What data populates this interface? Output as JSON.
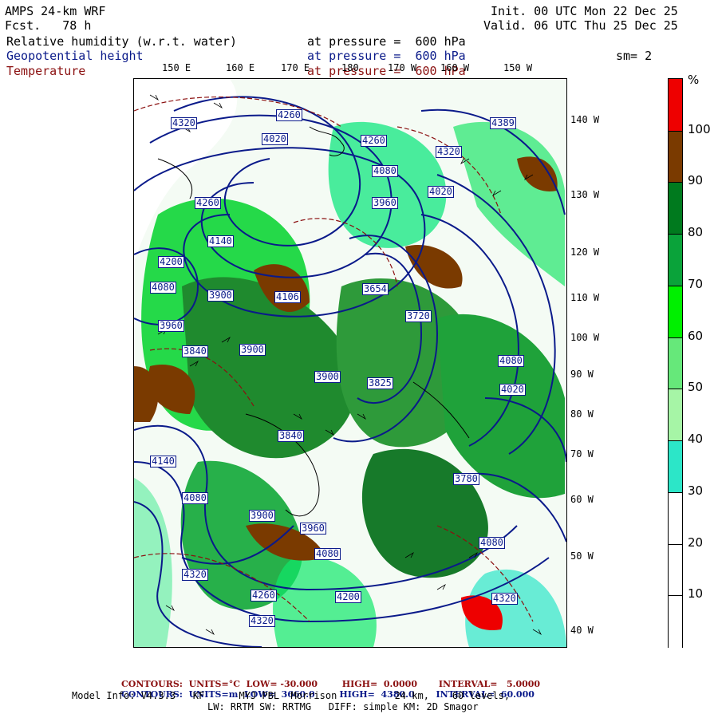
{
  "header": {
    "model": "AMPS 24-km WRF",
    "fcst": "Fcst.   78 h",
    "init": "Init. 00 UTC Mon 22 Dec 25",
    "valid": "Valid. 06 UTC Thu 25 Dec 25"
  },
  "fields": [
    {
      "name": "Relative humidity (w.r.t. water)",
      "level": "at pressure =  600 hPa",
      "color": "#000000"
    },
    {
      "name": "Geopotential height",
      "level": "at pressure =  600 hPa",
      "color": "#0a1a8a"
    },
    {
      "name": "Temperature",
      "level": "at pressure =  600 hPa",
      "color": "#8b1010"
    }
  ],
  "smoothing": "sm= 2",
  "lon_labels": [
    "150 E",
    "160 E",
    "170 E",
    "180",
    "170 W",
    "160 W",
    "150 W"
  ],
  "lat_labels": [
    "140 W",
    "130 W",
    "120 W",
    "110 W",
    "100 W",
    "90 W",
    "80 W",
    "70 W",
    "60 W",
    "50 W",
    "40 W"
  ],
  "height_contour_labels": [
    "4320",
    "4260",
    "4200",
    "4140",
    "4080",
    "4020",
    "3960",
    "3900",
    "3840",
    "3825",
    "3780",
    "3720",
    "3654",
    "4106",
    "4389"
  ],
  "colorbar": {
    "unit": "%",
    "levels": [
      "100",
      "90",
      "80",
      "70",
      "60",
      "50",
      "40",
      "30",
      "20",
      "10"
    ],
    "colors": [
      "#ee0000",
      "#7a3a00",
      "#007a1e",
      "#0aa33a",
      "#00f000",
      "#66e87a",
      "#a6f5a6",
      "#2ce6c8",
      "#ffffff",
      "#ffffff",
      "#ffffff"
    ]
  },
  "footer": {
    "temp": {
      "label": "CONTOURS:",
      "units": "UNITS=°C",
      "low": "LOW= -30.000",
      "high": "HIGH=  0.0000",
      "interval": "INTERVAL=   5.0000"
    },
    "height": {
      "label": "CONTOURS:",
      "units": "UNITS=m",
      "low": "LOW=  3660.0",
      "high": "HIGH=  4380.0",
      "interval": "INTERVAL=  60.000"
    },
    "model_info_1": "Model Info: V4.3.3   KF      MYJ PBL  Morrison          24 km,    60 levels,",
    "model_info_2": "LW: RRTM SW: RRTMG   DIFF: simple KM: 2D Smagor"
  }
}
